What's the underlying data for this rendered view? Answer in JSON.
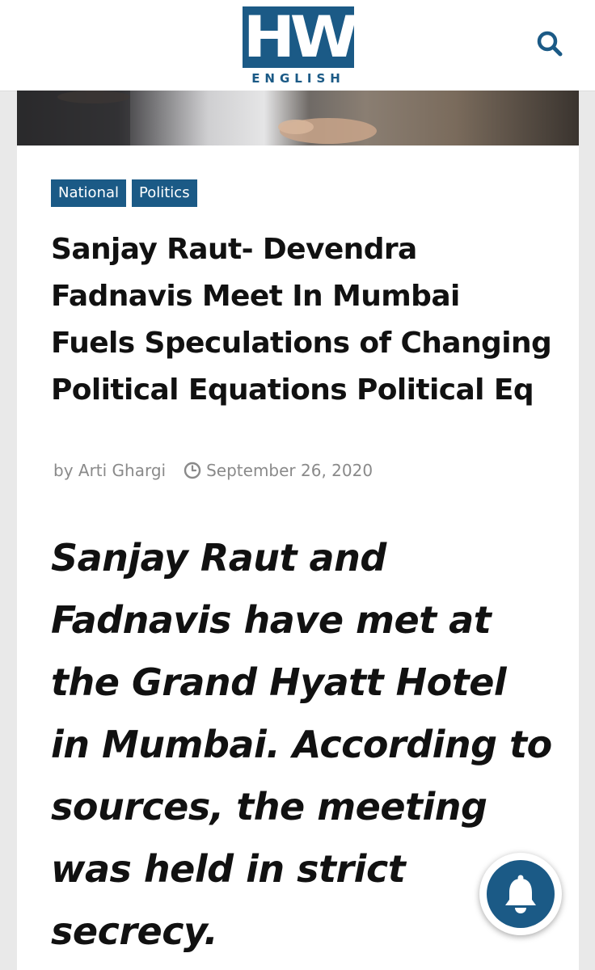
{
  "header": {
    "logo_letters": "HW",
    "logo_sub": "ENGLISH",
    "search_icon": "search-icon"
  },
  "article": {
    "tags": [
      "National",
      "Politics"
    ],
    "title": "Sanjay Raut- Devendra Fadnavis Meet In Mumbai Fuels Speculations of Changing Political Equations Political Eq",
    "author": "by Arti Ghargi",
    "date": "September 26, 2020",
    "lede": "Sanjay Raut and Fadnavis have met at the Grand Hyatt Hotel in Mumbai. According to sources, the meeting was held in strict secrecy."
  },
  "notification": {
    "icon": "bell-icon"
  },
  "colors": {
    "brand": "#1b5a86",
    "text": "#111111",
    "meta": "#8a8a8a"
  }
}
